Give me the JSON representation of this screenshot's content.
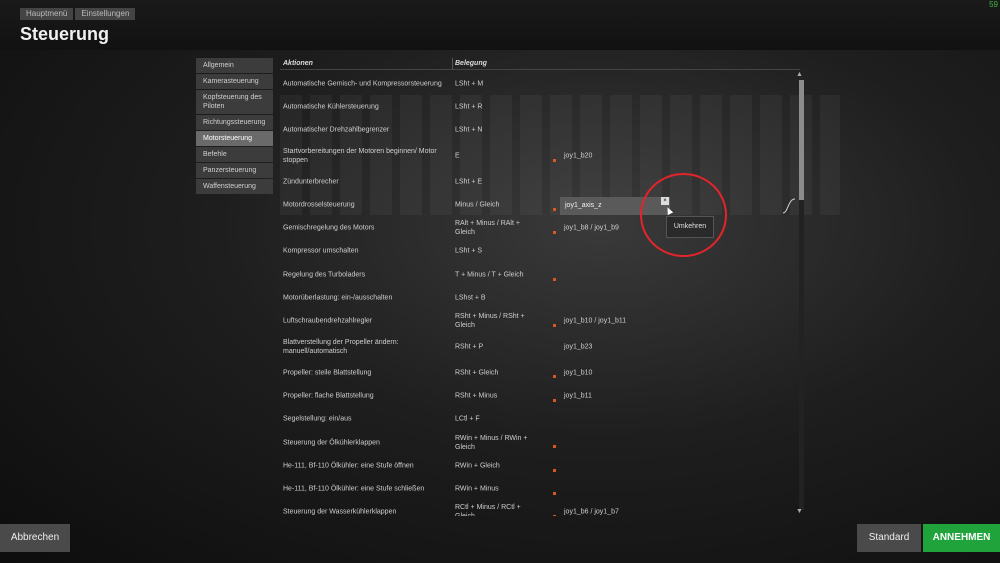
{
  "header": {
    "breadcrumbs": [
      "Hauptmenü",
      "Einstellungen"
    ],
    "title": "Steuerung",
    "fps": "59"
  },
  "sidebar": {
    "items": [
      {
        "label": "Allgemein",
        "active": false
      },
      {
        "label": "Kamerasteuerung",
        "active": false
      },
      {
        "label": "Kopfsteuerung des Piloten",
        "active": false
      },
      {
        "label": "Richtungssteuerung",
        "active": false
      },
      {
        "label": "Motorsteuerung",
        "active": true
      },
      {
        "label": "Befehle",
        "active": false
      },
      {
        "label": "Panzersteuerung",
        "active": false
      },
      {
        "label": "Waffensteuerung",
        "active": false
      }
    ]
  },
  "table": {
    "col_actions": "Aktionen",
    "col_binding": "Belegung",
    "rows": [
      {
        "action": "Automatische Gemisch- und Kompressorsteuerung",
        "key": "LSht + M",
        "joy": ""
      },
      {
        "action": "Automatische Kühlersteuerung",
        "key": "LSht + R",
        "joy": ""
      },
      {
        "action": "Automatischer Drehzahlbegrenzer",
        "key": "LSht + N",
        "joy": ""
      },
      {
        "action": "Startvorbereitungen der Motoren beginnen/ Motor stoppen",
        "key": "E",
        "joy": "joy1_b20"
      },
      {
        "action": "Zündunterbrecher",
        "key": "LSht + E",
        "joy": ""
      },
      {
        "action": "Motordrosselsteuerung",
        "key": "Minus / Gleich",
        "joy": ""
      },
      {
        "action": "Gemischregelung des Motors",
        "key": "RAlt + Minus / RAlt + Gleich",
        "joy": "joy1_b8 / joy1_b9"
      },
      {
        "action": "Kompressor umschalten",
        "key": "LSht + S",
        "joy": ""
      },
      {
        "action": "Regelung des Turboladers",
        "key": "T + Minus / T + Gleich",
        "joy": ""
      },
      {
        "action": "Motorüberlastung: ein-/ausschalten",
        "key": "LShst + B",
        "joy": ""
      },
      {
        "action": "Luftschraubendrehzahlregler",
        "key": "RSht + Minus / RSht + Gleich",
        "joy": "joy1_b10 / joy1_b11"
      },
      {
        "action": "Blattverstellung der Propeller ändern: manuell/automatisch",
        "key": "RSht + P",
        "joy": "joy1_b23"
      },
      {
        "action": "Propeller: steile Blattstellung",
        "key": "RSht + Gleich",
        "joy": "joy1_b10"
      },
      {
        "action": "Propeller: flache Blattstellung",
        "key": "RSht + Minus",
        "joy": "joy1_b11"
      },
      {
        "action": "Segelstellung: ein/aus",
        "key": "LCtl + F",
        "joy": ""
      },
      {
        "action": "Steuerung der Ölkühlerklappen",
        "key": "RWin + Minus / RWin + Gleich",
        "joy": ""
      },
      {
        "action": "He-111, Bf-110 Ölkühler: eine Stufe öffnen",
        "key": "RWin + Gleich",
        "joy": ""
      },
      {
        "action": "He-111, Bf-110 Ölkühler: eine Stufe schließen",
        "key": "RWin + Minus",
        "joy": ""
      },
      {
        "action": "Steuerung der Wasserkühlerklappen",
        "key": "RCtl + Minus / RCtl + Gleich",
        "joy": "joy1_b6 / joy1_b7"
      }
    ]
  },
  "axis_field": {
    "value": "joy1_axis_z",
    "button": "×"
  },
  "context_menu": {
    "label": "Umkehren"
  },
  "scroll": {
    "up": "▲",
    "down": "▼"
  },
  "buttons": {
    "cancel": "Abbrechen",
    "default": "Standard",
    "apply": "ANNEHMEN"
  },
  "colors": {
    "apply": "#1fa33a",
    "highlight": "#e3242b",
    "marker": "#d65a1e"
  }
}
